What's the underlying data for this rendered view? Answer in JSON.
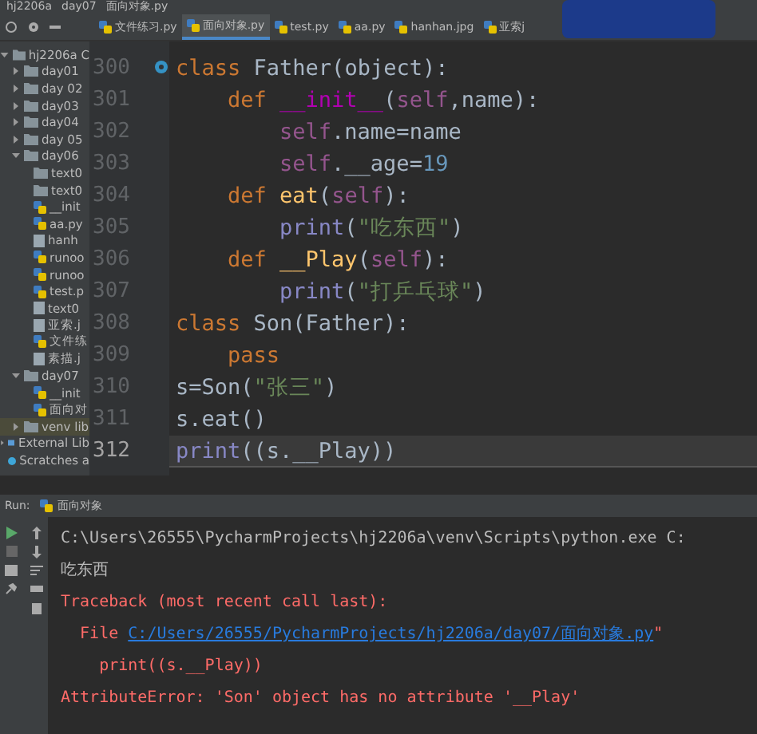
{
  "breadcrumb": [
    "hj2206a",
    "day07",
    "面向对象.py"
  ],
  "tabs": [
    {
      "label": "文件练习.py",
      "selected": false
    },
    {
      "label": "面向对象.py",
      "selected": true
    },
    {
      "label": "test.py",
      "selected": false
    },
    {
      "label": "aa.py",
      "selected": false
    },
    {
      "label": "hanhan.jpg",
      "selected": false
    },
    {
      "label": "亚索j",
      "selected": false
    }
  ],
  "project_tree": [
    {
      "label": "hj2206a C",
      "kind": "folder",
      "expanded": true,
      "selected": false,
      "children": [
        {
          "label": "day01",
          "kind": "folder",
          "expanded": false,
          "selected": false
        },
        {
          "label": "day 02",
          "kind": "folder",
          "expanded": false,
          "selected": false
        },
        {
          "label": "day03",
          "kind": "folder",
          "expanded": false,
          "selected": false
        },
        {
          "label": "day04",
          "kind": "folder",
          "expanded": false,
          "selected": false
        },
        {
          "label": "day 05",
          "kind": "folder",
          "expanded": false,
          "selected": false
        },
        {
          "label": "day06",
          "kind": "folder",
          "expanded": true,
          "selected": false,
          "children": [
            {
              "label": "text0",
              "kind": "folder",
              "selected": false
            },
            {
              "label": "text0",
              "kind": "folder",
              "selected": false
            },
            {
              "label": "__init",
              "kind": "python",
              "selected": false
            },
            {
              "label": "aa.py",
              "kind": "python",
              "selected": false
            },
            {
              "label": "hanh",
              "kind": "file",
              "selected": false
            },
            {
              "label": "runoo",
              "kind": "python",
              "selected": false
            },
            {
              "label": "runoo",
              "kind": "python",
              "selected": false
            },
            {
              "label": "test.p",
              "kind": "python",
              "selected": false
            },
            {
              "label": "text0",
              "kind": "file",
              "selected": false
            },
            {
              "label": "亚索.j",
              "kind": "file",
              "selected": false
            },
            {
              "label": "文件练",
              "kind": "python",
              "selected": false
            },
            {
              "label": "素描.j",
              "kind": "file",
              "selected": false
            }
          ]
        },
        {
          "label": "day07",
          "kind": "folder",
          "expanded": true,
          "selected": false,
          "children": [
            {
              "label": "__init",
              "kind": "python",
              "selected": false
            },
            {
              "label": "面向对",
              "kind": "python",
              "selected": false
            }
          ]
        },
        {
          "label": "venv lib",
          "kind": "folder",
          "expanded": false,
          "selected": true
        }
      ]
    },
    {
      "label": "External Lib",
      "kind": "library",
      "expanded": false,
      "selected": false
    },
    {
      "label": "Scratches a",
      "kind": "scratch",
      "selected": false
    }
  ],
  "editor": {
    "lines": [
      {
        "number": "300",
        "current": false,
        "tokens": [
          {
            "kind": "keyword",
            "text": "class "
          },
          {
            "kind": "plain",
            "text": "Father("
          },
          {
            "kind": "plain",
            "text": "object"
          },
          {
            "kind": "plain",
            "text": "):"
          }
        ]
      },
      {
        "number": "301",
        "current": false,
        "tokens": [
          {
            "kind": "keyword",
            "text": "    def "
          },
          {
            "kind": "magic",
            "text": "__init__"
          },
          {
            "kind": "plain",
            "text": "("
          },
          {
            "kind": "self",
            "text": "self"
          },
          {
            "kind": "plain",
            "text": ",name):"
          }
        ]
      },
      {
        "number": "302",
        "current": false,
        "tokens": [
          {
            "kind": "self",
            "text": "        self"
          },
          {
            "kind": "plain",
            "text": ".name=name"
          }
        ]
      },
      {
        "number": "303",
        "current": false,
        "tokens": [
          {
            "kind": "self",
            "text": "        self"
          },
          {
            "kind": "plain",
            "text": ".__age="
          },
          {
            "kind": "number",
            "text": "19"
          }
        ]
      },
      {
        "number": "304",
        "current": false,
        "tokens": [
          {
            "kind": "keyword",
            "text": "    def "
          },
          {
            "kind": "function",
            "text": "eat"
          },
          {
            "kind": "plain",
            "text": "("
          },
          {
            "kind": "self",
            "text": "self"
          },
          {
            "kind": "plain",
            "text": "):"
          }
        ]
      },
      {
        "number": "305",
        "current": false,
        "tokens": [
          {
            "kind": "builtin",
            "text": "        print"
          },
          {
            "kind": "plain",
            "text": "("
          },
          {
            "kind": "string",
            "text": "\"吃东西\""
          },
          {
            "kind": "plain",
            "text": ")"
          }
        ]
      },
      {
        "number": "306",
        "current": false,
        "tokens": [
          {
            "kind": "keyword",
            "text": "    def "
          },
          {
            "kind": "function",
            "text": "__Play"
          },
          {
            "kind": "plain",
            "text": "("
          },
          {
            "kind": "self",
            "text": "self"
          },
          {
            "kind": "plain",
            "text": "):"
          }
        ]
      },
      {
        "number": "307",
        "current": false,
        "tokens": [
          {
            "kind": "builtin",
            "text": "        print"
          },
          {
            "kind": "plain",
            "text": "("
          },
          {
            "kind": "string",
            "text": "\"打乒乓球\""
          },
          {
            "kind": "plain",
            "text": ")"
          }
        ]
      },
      {
        "number": "308",
        "current": false,
        "tokens": [
          {
            "kind": "keyword",
            "text": "class "
          },
          {
            "kind": "plain",
            "text": "Son(Father):"
          }
        ]
      },
      {
        "number": "309",
        "current": false,
        "tokens": [
          {
            "kind": "keyword",
            "text": "    pass"
          }
        ]
      },
      {
        "number": "310",
        "current": false,
        "tokens": [
          {
            "kind": "plain",
            "text": "s=Son("
          },
          {
            "kind": "string",
            "text": "\"张三\""
          },
          {
            "kind": "plain",
            "text": ")"
          }
        ]
      },
      {
        "number": "311",
        "current": false,
        "tokens": [
          {
            "kind": "plain",
            "text": "s.eat()"
          }
        ]
      },
      {
        "number": "312",
        "current": true,
        "tokens": [
          {
            "kind": "builtin",
            "text": "print"
          },
          {
            "kind": "plain",
            "text": "((s.__Play))"
          }
        ]
      }
    ]
  },
  "run_panel": {
    "label": "Run:",
    "tab": "面向对象",
    "console": [
      {
        "kind": "plain",
        "text": "C:\\Users\\26555\\PycharmProjects\\hj2206a\\venv\\Scripts\\python.exe C:"
      },
      {
        "kind": "plain",
        "text": "吃东西"
      },
      {
        "kind": "error",
        "text": "Traceback (most recent call last):"
      },
      {
        "kind": "file",
        "text": "  File ",
        "link": "C:/Users/26555/PycharmProjects/hj2206a/day07/面向对象.py",
        "after": "\""
      },
      {
        "kind": "error",
        "text": "    print((s.__Play))"
      },
      {
        "kind": "error",
        "text": "AttributeError: 'Son' object has no attribute '__Play'"
      }
    ]
  }
}
